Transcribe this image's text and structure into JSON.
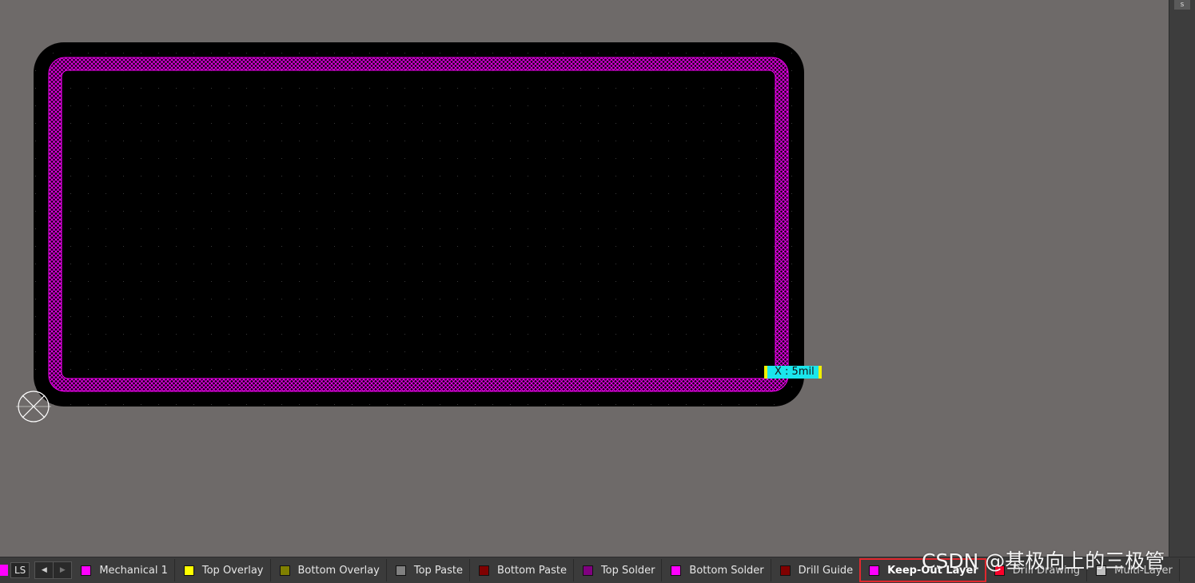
{
  "colors": {
    "canvas_bg": "#6e6a69",
    "board": "#000000",
    "keepout": "#ff00ff",
    "measure_bg": "#1ae6ec",
    "measure_border": "#f0f000",
    "highlight": "#e0282e"
  },
  "measure": {
    "label": "X : 5mil"
  },
  "right_panel": {
    "tab_label": "s"
  },
  "layer_bar": {
    "ls_label": "LS",
    "ls_color": "#ff00ff",
    "layers": [
      {
        "name": "Mechanical 1",
        "color": "#ff00ff",
        "active": false
      },
      {
        "name": "Top Overlay",
        "color": "#ffff00",
        "active": false
      },
      {
        "name": "Bottom Overlay",
        "color": "#808000",
        "active": false
      },
      {
        "name": "Top Paste",
        "color": "#808080",
        "active": false
      },
      {
        "name": "Bottom Paste",
        "color": "#800000",
        "active": false
      },
      {
        "name": "Top Solder",
        "color": "#800080",
        "active": false
      },
      {
        "name": "Bottom Solder",
        "color": "#ff00ff",
        "active": false
      },
      {
        "name": "Drill Guide",
        "color": "#800000",
        "active": false
      },
      {
        "name": "Keep-Out Layer",
        "color": "#ff00ff",
        "active": true
      },
      {
        "name": "Drill Drawing",
        "color": "#ff002a",
        "active": false
      },
      {
        "name": "Multi-Layer",
        "color": "#c0c0c0",
        "active": false
      }
    ]
  },
  "watermark": "CSDN @基极向上的三极管"
}
